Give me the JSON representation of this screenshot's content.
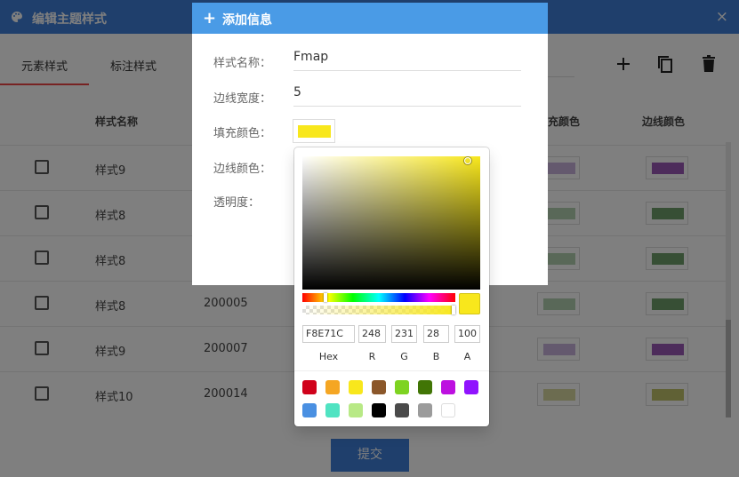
{
  "window": {
    "title": "编辑主题样式",
    "close": "×"
  },
  "tabs": [
    "元素样式",
    "标注样式"
  ],
  "table": {
    "headers": [
      "样式名称",
      "充颜色",
      "边线颜色"
    ],
    "rows": [
      {
        "name": "样式9",
        "code": "",
        "fill": "#c9b3dc",
        "stroke": "#9b59b6"
      },
      {
        "name": "样式8",
        "code": "",
        "fill": "#b3d1b0",
        "stroke": "#6f9e6a"
      },
      {
        "name": "样式8",
        "code": "",
        "fill": "#b3d1b0",
        "stroke": "#6f9e6a"
      },
      {
        "name": "样式8",
        "code": "200005",
        "fill": "#b3d1b0",
        "stroke": "#6f9e6a"
      },
      {
        "name": "样式9",
        "code": "200007",
        "fill": "#c9b3dc",
        "stroke": "#9b59b6"
      },
      {
        "name": "样式10",
        "code": "200014",
        "fill": "#d8d9a0",
        "stroke": "#c1c26a"
      }
    ]
  },
  "submit_label": "提交",
  "dialog": {
    "plus": "+",
    "title": "添加信息",
    "fields": {
      "style_name_label": "样式名称：",
      "style_name_value": "Fmap",
      "stroke_width_label": "边线宽度：",
      "stroke_width_value": "5",
      "fill_color_label": "填充颜色：",
      "fill_color_value": "#f8e71c",
      "stroke_color_label": "边线颜色：",
      "opacity_label": "透明度："
    }
  },
  "color_picker": {
    "hex": "F8E71C",
    "r": "248",
    "g": "231",
    "b": "28",
    "a": "100",
    "hue_fraction": 0.15,
    "alpha_fraction": 1.0,
    "labels": {
      "hex": "Hex",
      "r": "R",
      "g": "G",
      "b": "B",
      "a": "A"
    },
    "presets": [
      "#d0021b",
      "#f5a623",
      "#f8e71c",
      "#8b572a",
      "#7ed321",
      "#417505",
      "#bd10e0",
      "#9013fe",
      "#4a90e2",
      "#50e3c2",
      "#b8e986",
      "#000000",
      "#4a4a4a",
      "#9b9b9b",
      "#ffffff"
    ]
  }
}
